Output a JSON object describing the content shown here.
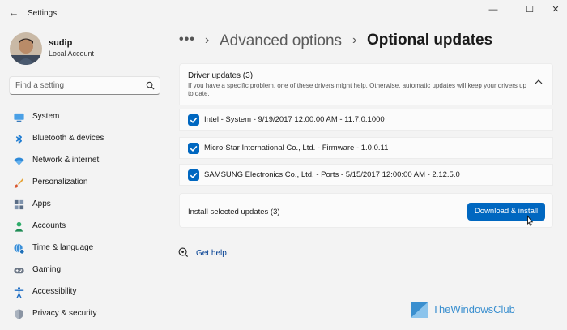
{
  "window": {
    "title": "Settings",
    "back_glyph": "←",
    "minimize_glyph": "—",
    "maximize_glyph": "☐",
    "close_glyph": "✕"
  },
  "user": {
    "name": "sudip",
    "account_type": "Local Account"
  },
  "search": {
    "placeholder": "Find a setting",
    "icon": "search-icon"
  },
  "sidebar": {
    "items": [
      {
        "label": "System",
        "icon": "monitor-icon"
      },
      {
        "label": "Bluetooth & devices",
        "icon": "bluetooth-icon"
      },
      {
        "label": "Network & internet",
        "icon": "wifi-icon"
      },
      {
        "label": "Personalization",
        "icon": "brush-icon"
      },
      {
        "label": "Apps",
        "icon": "apps-icon"
      },
      {
        "label": "Accounts",
        "icon": "person-icon"
      },
      {
        "label": "Time & language",
        "icon": "globe-clock-icon"
      },
      {
        "label": "Gaming",
        "icon": "gamepad-icon"
      },
      {
        "label": "Accessibility",
        "icon": "accessibility-icon"
      },
      {
        "label": "Privacy & security",
        "icon": "shield-icon"
      }
    ]
  },
  "breadcrumb": {
    "more": "•••",
    "sep": "›",
    "parent": "Advanced options",
    "current": "Optional updates"
  },
  "driver_updates": {
    "title": "Driver updates (3)",
    "description": "If you have a specific problem, one of these drivers might help. Otherwise, automatic updates will keep your drivers up to date.",
    "items": [
      {
        "label": "Intel - System - 9/19/2017 12:00:00 AM - 11.7.0.1000",
        "checked": true
      },
      {
        "label": "Micro-Star International Co., Ltd. - Firmware - 1.0.0.11",
        "checked": true
      },
      {
        "label": "SAMSUNG Electronics Co., Ltd.  - Ports - 5/15/2017 12:00:00 AM - 2.12.5.0",
        "checked": true
      }
    ]
  },
  "install": {
    "label": "Install selected updates (3)",
    "button_label": "Download & install"
  },
  "help": {
    "label": "Get help"
  },
  "watermark": {
    "text": "TheWindowsClub"
  },
  "colors": {
    "accent": "#0067c0",
    "background": "#f3f3f3",
    "card": "#fbfbfb"
  }
}
